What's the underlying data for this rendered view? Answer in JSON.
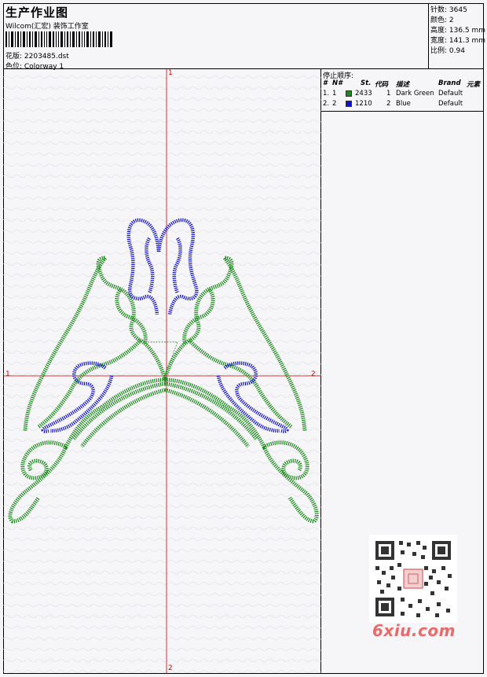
{
  "header": {
    "title": "生产作业图",
    "company": "Wilcom(汇宏) 装饰工作室",
    "design_line": "花版: 2203485.dst",
    "colorway_line": "色位: Colorway 1"
  },
  "stats": {
    "stitches": "针数: 3645",
    "colors": "颜色: 2",
    "height": "高度: 136.5 mm",
    "width": "宽度: 141.3 mm",
    "ratio": "比例: 0.94"
  },
  "stop_sequence": {
    "title": "停止顺序:",
    "columns": [
      "#",
      "N#",
      "St.",
      "代码",
      "描述",
      "Brand",
      "元素"
    ],
    "rows": [
      {
        "idx": "1.",
        "n": "1",
        "stitches": "2433",
        "code": "1",
        "desc": "Dark Green",
        "brand": "Default",
        "color": "#1a8a1a"
      },
      {
        "idx": "2.",
        "n": "2",
        "stitches": "1210",
        "code": "2",
        "desc": "Blue",
        "brand": "Default",
        "color": "#1010d0"
      }
    ]
  },
  "axes": {
    "top": "1",
    "bottom": "2",
    "left": "1",
    "right": "2",
    "color": "#d00000"
  },
  "watermark": {
    "logo": "6xiu.com"
  },
  "thread_colors": {
    "green": "#1a8a1a",
    "blue": "#1010d0"
  }
}
